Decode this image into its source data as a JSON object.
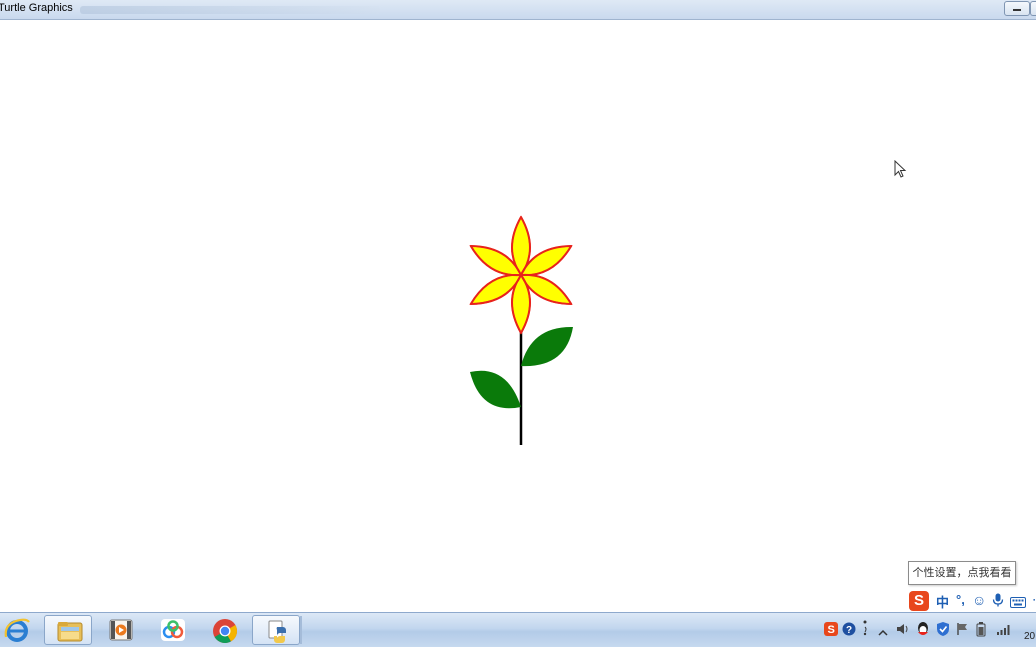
{
  "window": {
    "title": "Turtle Graphics"
  },
  "drawing": {
    "petal_fill": "#ffff00",
    "petal_outline": "#e8231c",
    "leaf_color": "#0a7a0a",
    "stem_color": "#000000",
    "petal_count": 6
  },
  "ime": {
    "tooltip": "个性设置，点我看看",
    "logo": "S",
    "mode": "中",
    "punct": "°,",
    "more": "⋯"
  },
  "taskbar": {
    "items": [
      {
        "name": "ie-icon"
      },
      {
        "name": "file-explorer-icon"
      },
      {
        "name": "media-player-icon"
      },
      {
        "name": "baidu-netdisk-icon"
      },
      {
        "name": "chrome-icon"
      },
      {
        "name": "python-icon"
      }
    ],
    "clock": "20"
  },
  "colors": {
    "titlebar": "#c9d9ee",
    "taskbar": "#c2d6ee",
    "sogou": "#e8471c"
  }
}
